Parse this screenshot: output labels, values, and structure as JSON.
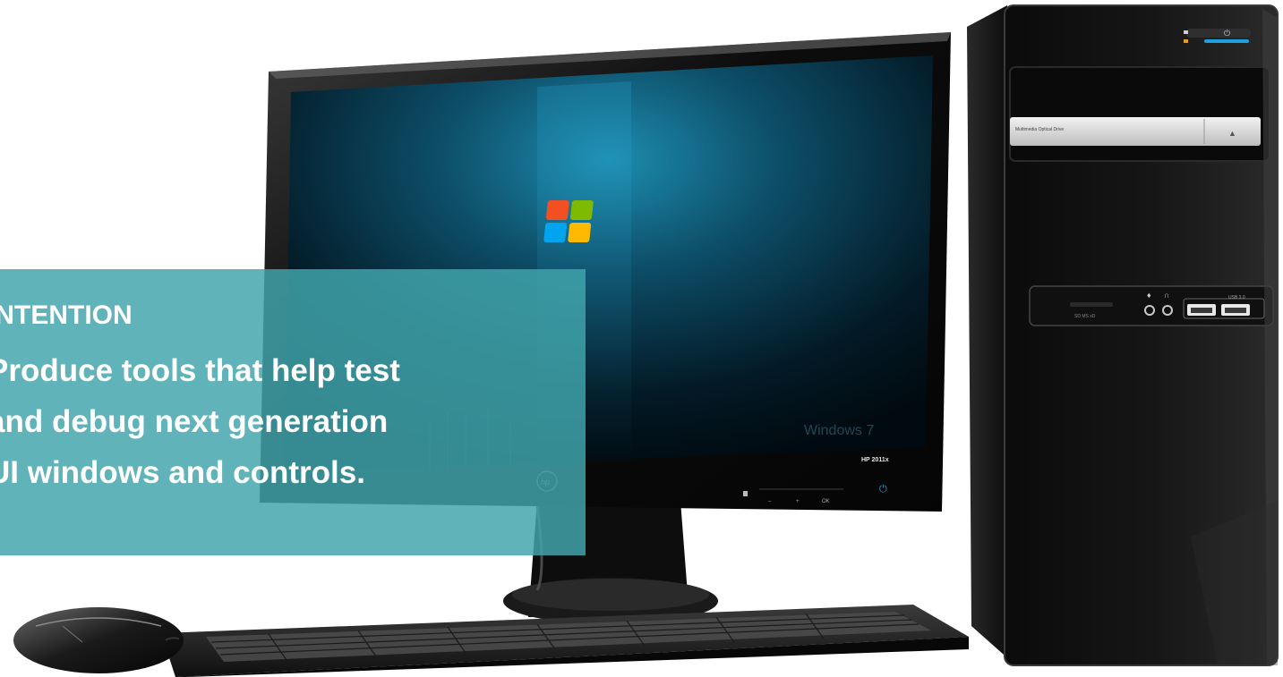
{
  "overlay": {
    "heading": "INTENTION",
    "lines": [
      "Produce tools that help test",
      "and debug next generation",
      "UI windows and controls."
    ]
  },
  "monitor": {
    "model_label": "HP 2011x",
    "os_watermark": "Windows 7",
    "button_labels": [
      "–",
      "+",
      "OK"
    ]
  },
  "tower": {
    "drive_label": "Multimedia Optical Drive",
    "card_reader_label": "SD   MS   xD",
    "usb_label": "USB 3.0"
  },
  "colors": {
    "overlay": "#40a5ac",
    "screen_glow": "#1b7fa0",
    "power_led": "#1e9fe0"
  }
}
